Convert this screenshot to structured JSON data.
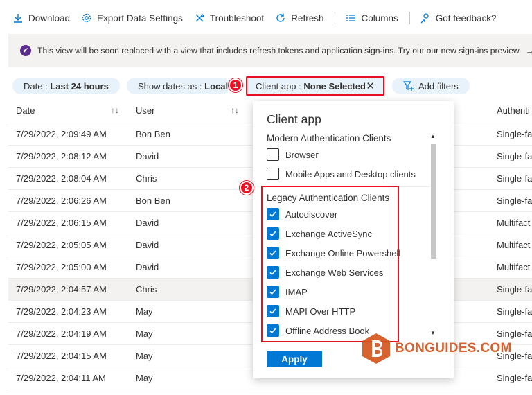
{
  "toolbar": {
    "download": "Download",
    "export": "Export Data Settings",
    "troubleshoot": "Troubleshoot",
    "refresh": "Refresh",
    "columns": "Columns",
    "feedback": "Got feedback?"
  },
  "banner": {
    "text": "This view will be soon replaced with a view that includes refresh tokens and application sign-ins. Try out our new sign-ins preview.",
    "arrow": "→"
  },
  "filters": {
    "date_label": "Date : ",
    "date_value": "Last 24 hours",
    "show_label": "Show dates as : ",
    "show_value": "Local",
    "client_label": "Client app : ",
    "client_value": "None Selected",
    "client_clear": "✕",
    "add": "Add filters"
  },
  "badges": {
    "one": "1",
    "two": "2"
  },
  "table": {
    "headers": {
      "date": "Date",
      "user": "User",
      "auth": "Authenti"
    },
    "rows": [
      {
        "date": "7/29/2022, 2:09:49 AM",
        "user": "Bon Ben",
        "auth": "Single-fa"
      },
      {
        "date": "7/29/2022, 2:08:12 AM",
        "user": "David",
        "auth": "Single-fa"
      },
      {
        "date": "7/29/2022, 2:08:04 AM",
        "user": "Chris",
        "auth": "Single-fa"
      },
      {
        "date": "7/29/2022, 2:06:26 AM",
        "user": "Bon Ben",
        "auth": "Single-fa"
      },
      {
        "date": "7/29/2022, 2:06:15 AM",
        "user": "David",
        "auth": "Multifact"
      },
      {
        "date": "7/29/2022, 2:05:05 AM",
        "user": "David",
        "auth": "Multifact"
      },
      {
        "date": "7/29/2022, 2:05:00 AM",
        "user": "David",
        "auth": "Multifact"
      },
      {
        "date": "7/29/2022, 2:04:57 AM",
        "user": "Chris",
        "auth": "Single-fa"
      },
      {
        "date": "7/29/2022, 2:04:23 AM",
        "user": "May",
        "auth": "Single-fa"
      },
      {
        "date": "7/29/2022, 2:04:19 AM",
        "user": "May",
        "auth": "Single-fa"
      },
      {
        "date": "7/29/2022, 2:04:15 AM",
        "user": "May",
        "auth": "Single-fa"
      },
      {
        "date": "7/29/2022, 2:04:11 AM",
        "user": "May",
        "auth": "Single-fa"
      }
    ]
  },
  "dropdown": {
    "title": "Client app",
    "modern_group": "Modern Authentication Clients",
    "modern_options": [
      {
        "label": "Browser",
        "checked": false
      },
      {
        "label": "Mobile Apps and Desktop clients",
        "checked": false
      }
    ],
    "legacy_group": "Legacy Authentication Clients",
    "legacy_options": [
      {
        "label": "Autodiscover",
        "checked": true
      },
      {
        "label": "Exchange ActiveSync",
        "checked": true
      },
      {
        "label": "Exchange Online Powershell",
        "checked": true
      },
      {
        "label": "Exchange Web Services",
        "checked": true
      },
      {
        "label": "IMAP",
        "checked": true
      },
      {
        "label": "MAPI Over HTTP",
        "checked": true
      },
      {
        "label": "Offline Address Book",
        "checked": true
      }
    ],
    "apply": "Apply"
  },
  "watermark": {
    "text": "BONGUIDES.COM"
  },
  "colors": {
    "accent": "#0078d4",
    "highlight": "#e81123",
    "pill": "#e8f2fb",
    "brand": "#d4561f"
  }
}
